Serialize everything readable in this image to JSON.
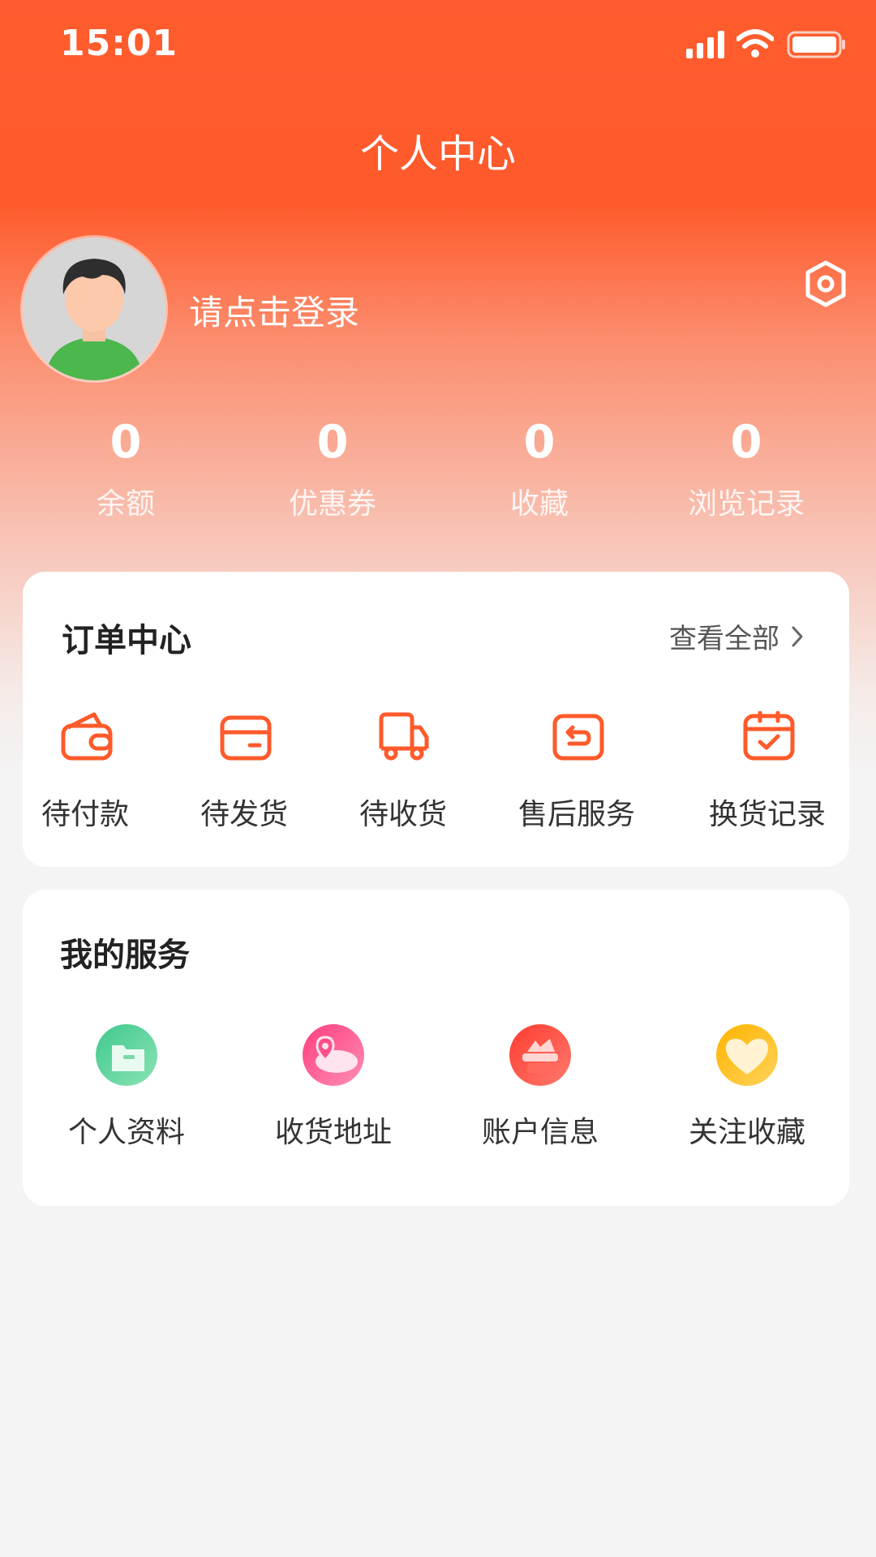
{
  "status_bar": {
    "time": "15:01"
  },
  "header": {
    "title": "个人中心"
  },
  "profile": {
    "login_prompt": "请点击登录"
  },
  "stats": [
    {
      "value": "0",
      "label": "余额"
    },
    {
      "value": "0",
      "label": "优惠券"
    },
    {
      "value": "0",
      "label": "收藏"
    },
    {
      "value": "0",
      "label": "浏览记录"
    }
  ],
  "orders": {
    "title": "订单中心",
    "view_all": "查看全部",
    "items": [
      {
        "label": "待付款",
        "icon": "wallet-icon"
      },
      {
        "label": "待发货",
        "icon": "card-icon"
      },
      {
        "label": "待收货",
        "icon": "truck-icon"
      },
      {
        "label": "售后服务",
        "icon": "return-icon"
      },
      {
        "label": "换货记录",
        "icon": "calendar-check-icon"
      }
    ]
  },
  "services": {
    "title": "我的服务",
    "items": [
      {
        "label": "个人资料",
        "icon": "folder-icon"
      },
      {
        "label": "收货地址",
        "icon": "map-pin-icon"
      },
      {
        "label": "账户信息",
        "icon": "account-icon"
      },
      {
        "label": "关注收藏",
        "icon": "heart-icon"
      }
    ]
  },
  "colors": {
    "brand": "#ff5a2b",
    "icon_stroke": "#ff5a2b",
    "card_bg": "#ffffff",
    "page_bg": "#f4f4f4"
  }
}
